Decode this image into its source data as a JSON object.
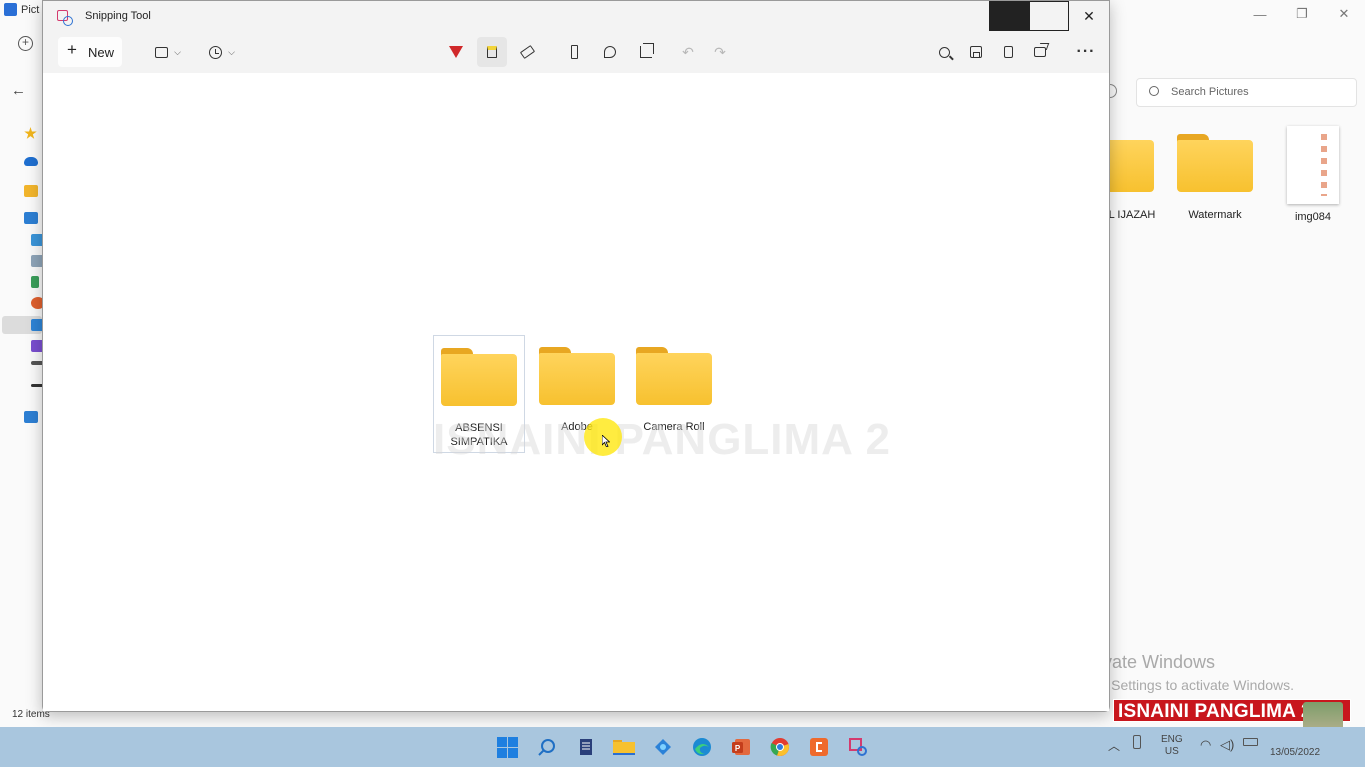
{
  "explorer": {
    "title": "Pict",
    "search_placeholder": "Search Pictures",
    "status": "12 items",
    "items": [
      {
        "label": "L IJAZAH",
        "kind": "folder"
      },
      {
        "label": "Watermark",
        "kind": "folder"
      },
      {
        "label": "img084",
        "kind": "image"
      }
    ]
  },
  "snip": {
    "title": "Snipping Tool",
    "new_label": "New"
  },
  "canvas": {
    "folders": [
      {
        "label": "ABSENSI SIMPATIKA"
      },
      {
        "label": "Adobe"
      },
      {
        "label": "Camera Roll"
      }
    ],
    "watermark": "ISNAINI PANGLIMA 2"
  },
  "activation": {
    "line1": "Activate Windows",
    "line2": "Go to Settings to activate Windows."
  },
  "brand": "ISNAINI PANGLIMA 2",
  "tray": {
    "lang": "ENG",
    "region": "US",
    "date": "13/05/2022"
  },
  "colors": {
    "highlighter": "#f2d43a",
    "pen": "#d0282a",
    "taskbar": "#a9c6de",
    "folder": "#f7c12f"
  }
}
